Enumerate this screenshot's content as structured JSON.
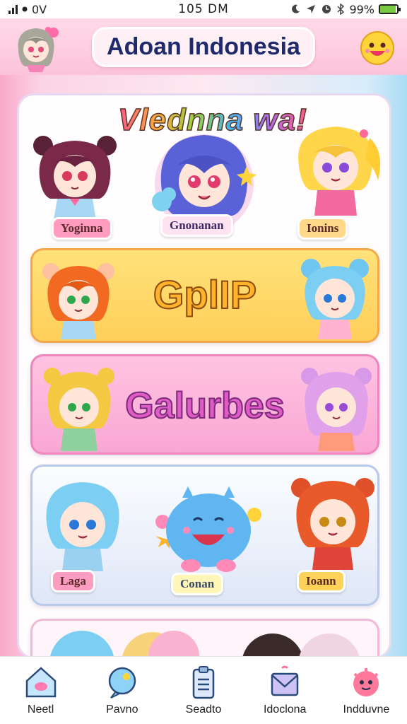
{
  "status_bar": {
    "carrier": "0V",
    "time": "105 DM",
    "battery": "99%"
  },
  "header": {
    "title": "Adoan Indonesia",
    "avatar_icon": "chibi-girl-avatar-icon",
    "emoji_icon": "smiley-face-icon"
  },
  "hero": {
    "title": "Vlednna wa!",
    "characters": [
      {
        "name": "Yoginna"
      },
      {
        "name": "Gnonanan"
      },
      {
        "name": "Ionins"
      }
    ]
  },
  "cards": {
    "gplip": {
      "title": "GplIP"
    },
    "galurbes": {
      "title": "Galurbes"
    },
    "trio": {
      "characters": [
        {
          "name": "Laga"
        },
        {
          "name": "Conan"
        },
        {
          "name": "Ioann"
        }
      ]
    }
  },
  "nav": {
    "items": [
      {
        "label": "Neetl",
        "icon": "home-icon"
      },
      {
        "label": "Pavno",
        "icon": "search-bubble-icon"
      },
      {
        "label": "Seadto",
        "icon": "clipboard-icon"
      },
      {
        "label": "Idoclona",
        "icon": "mail-icon"
      },
      {
        "label": "Indduvne",
        "icon": "character-badge-icon"
      }
    ]
  },
  "colors": {
    "header_bg": "#fcc3da",
    "title_color": "#1f2a6b",
    "gplip_card": "#ffd96a",
    "galurbes_card": "#f9b3d9",
    "trio_card": "#e6ecf8"
  }
}
